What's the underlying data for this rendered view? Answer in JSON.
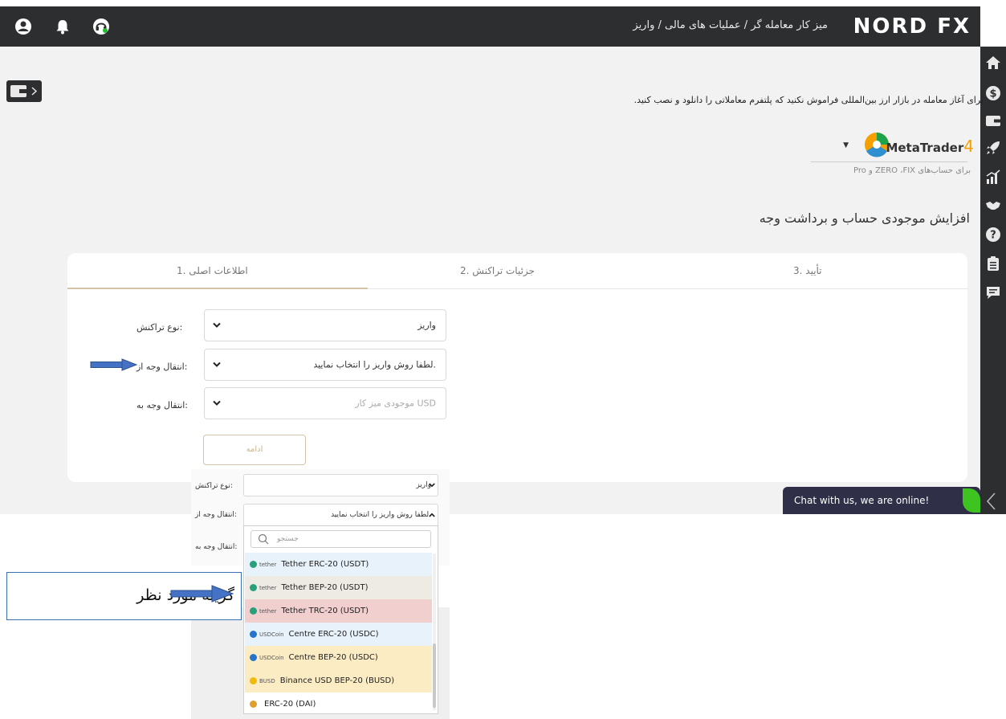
{
  "header": {
    "brand_logo": "NORD FX",
    "breadcrumb": "میز کار معامله گر / عملیات های مالی / واریز",
    "icons": [
      "user-icon",
      "bell-icon",
      "support-headset-icon"
    ]
  },
  "sidebar": {
    "icons": [
      "home-icon",
      "dollar-icon",
      "wallet-icon",
      "rocket-icon",
      "chart-icon",
      "handshake-icon",
      "help-icon",
      "clipboard-icon",
      "chat-icon"
    ]
  },
  "platform": {
    "hint": "برای آغاز معامله در بازار ارز بین‌المللی فراموش نکنید که پلتفرم معاملاتی را دانلود و نصب کنید.",
    "name": "MetaTrader",
    "version": "4",
    "subtitle": "برای حساب‌های ZERO ،FIX و Pro"
  },
  "main": {
    "title": "افزایش موجودی حساب و برداشت وجه",
    "steps": [
      {
        "label": "اطلاعات اصلی .1",
        "active": true
      },
      {
        "label": "جزئیات تراکنش .2",
        "active": false
      },
      {
        "label": "تأیید .3",
        "active": false
      }
    ],
    "form": {
      "transaction_type_label": ":نوع تراکنش",
      "transaction_type_value": "واریز",
      "transfer_from_label": ":انتقال وجه از",
      "transfer_from_value": ".لطفا روش واریز را انتخاب نمایید",
      "transfer_to_label": ":انتقال وجه به",
      "transfer_to_value": "USD موجودی میز کار",
      "continue_label": "ادامه"
    }
  },
  "chat": {
    "text": "Chat with us, we are online!"
  },
  "zoom": {
    "transaction_type_label": ":نوع تراکنش",
    "transaction_type_value": "واریز",
    "transfer_from_label": ":انتقال وجه از",
    "transfer_from_value": ".لطفا روش واریز را انتخاب نمایید",
    "transfer_to_label": ":انتقال وجه به",
    "search_placeholder": "جستجو",
    "options": [
      {
        "brand": "tether",
        "label": "Tether ERC-20 (USDT)",
        "bg": "#e8f2fa"
      },
      {
        "brand": "tether",
        "label": "Tether BEP-20 (USDT)",
        "bg": "#eeeae4"
      },
      {
        "brand": "tether",
        "label": "Tether TRC-20 (USDT)",
        "bg": "#f2cfcf"
      },
      {
        "brand": "USDCoin",
        "label": "Centre ERC-20 (USDC)",
        "bg": "#e8f2fa"
      },
      {
        "brand": "USDCoin",
        "label": "Centre BEP-20 (USDC)",
        "bg": "#fbecc4"
      },
      {
        "brand": "BUSD",
        "label": "Binance USD BEP-20 (BUSD)",
        "bg": "#fbecc4"
      },
      {
        "brand": "",
        "label": "ERC-20 (DAI)",
        "bg": "#ffffff"
      }
    ]
  },
  "annotation": {
    "callout": "گزینه مورد نظر"
  },
  "colors": {
    "topbar": "#2d2e30",
    "nord_green": "#1fbf2c",
    "metatrader_orange": "#f5a000",
    "step_accent": "#d4c3a7",
    "arrow_blue": "#3a6fb0",
    "chat_bg": "#2f2f47"
  }
}
